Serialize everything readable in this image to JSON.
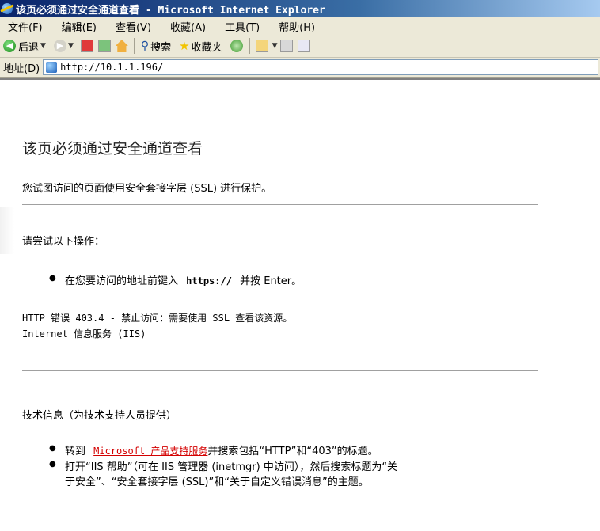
{
  "window": {
    "title": "该页必须通过安全通道查看 - Microsoft Internet Explorer"
  },
  "menu": [
    {
      "label": "文件(F)"
    },
    {
      "label": "编辑(E)"
    },
    {
      "label": "查看(V)"
    },
    {
      "label": "收藏(A)"
    },
    {
      "label": "工具(T)"
    },
    {
      "label": "帮助(H)"
    }
  ],
  "toolbar": {
    "back_label": "后退",
    "search_label": "搜索",
    "favorites_label": "收藏夹"
  },
  "addressbar": {
    "label": "地址(D)",
    "url": "http://10.1.1.196/"
  },
  "page": {
    "title": "该页必须通过安全通道查看",
    "subtitle": "您试图访问的页面使用安全套接字层 (SSL) 进行保护。",
    "try_heading": "请尝试以下操作：",
    "try_item_pre": "在您要访问的地址前键入",
    "try_item_bold": "https://",
    "try_item_post": "并按 Enter。",
    "error_line": "HTTP 错误 403.4 - 禁止访问：需要使用 SSL 查看该资源。",
    "server_line": "Internet 信息服务 (IIS)",
    "tech_heading": "技术信息（为技术支持人员提供）",
    "tech_item1_pre": "转到",
    "tech_item1_link": "Microsoft 产品支持服务",
    "tech_item1_post": "并搜索包括“HTTP”和“403”的标题。",
    "tech_item2_line1": "打开“IIS 帮助”（可在 IIS 管理器 (inetmgr) 中访问），然后搜索标题为“关",
    "tech_item2_line2": "于安全”、“安全套接字层 (SSL)”和“关于自定义错误消息”的主题。"
  },
  "colors": {
    "titlebar": "#0a246a",
    "chrome": "#ece9d8",
    "link": "#d40000"
  }
}
